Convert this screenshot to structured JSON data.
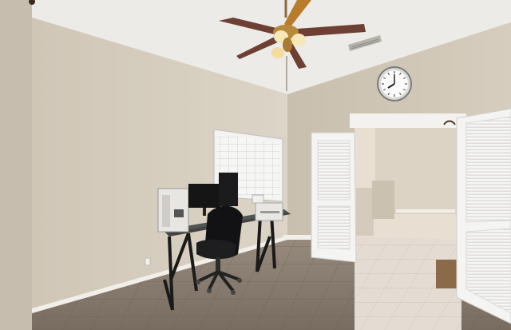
{
  "scene": {
    "kind": "photograph",
    "palette": {
      "ceiling": "#ecebe8",
      "wall_left": "#d8d0c1",
      "wall_back": "#cdc3b2",
      "floor_tile": "#8a7e72",
      "floor_tile_light": "#e4dcd2",
      "trim": "#f2efea",
      "door": "#f4f4f3",
      "fan_blade": "#6e3f33",
      "fan_brass": "#b78a3a"
    },
    "clock": {
      "hour_marks": [
        "12",
        "1",
        "2",
        "3",
        "4",
        "5",
        "6",
        "7",
        "8",
        "9",
        "10",
        "11"
      ]
    },
    "objects": [
      "ceiling-fan",
      "wall-clock",
      "calendar-board",
      "desk",
      "monitors",
      "office-chair",
      "printer",
      "bifold-door",
      "louvered-door"
    ]
  }
}
